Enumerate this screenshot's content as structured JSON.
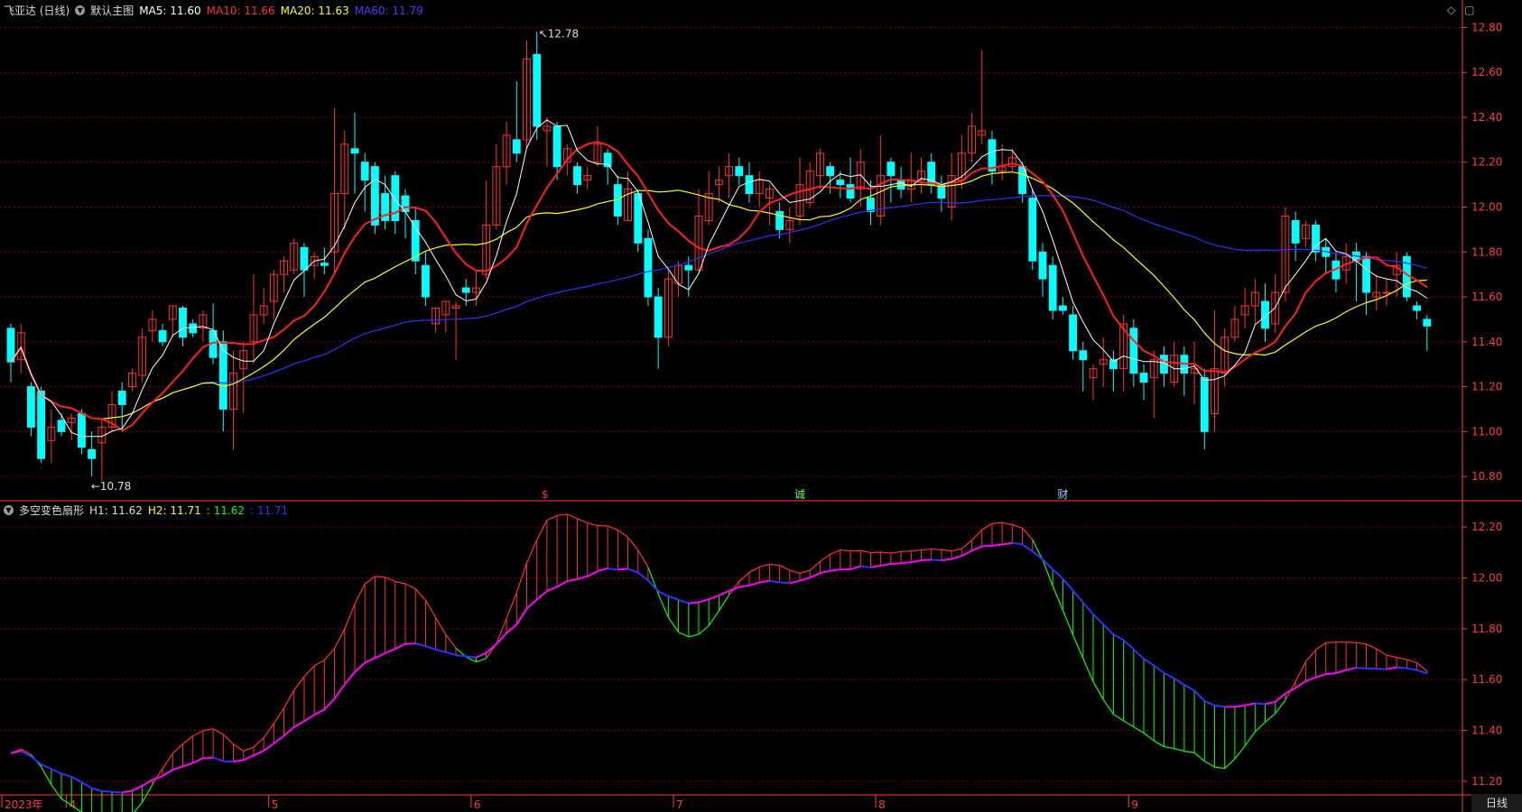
{
  "header": {
    "stock_name": "飞亚达 (日线)",
    "template": "默认主图",
    "ma5": "MA5: 11.60",
    "ma10": "MA10: 11.66",
    "ma20": "MA20: 11.63",
    "ma60": "MA60: 11.79"
  },
  "sub_header": {
    "indicator": "多空变色扇形",
    "h1": "H1: 11.62",
    "h2": "H2: 11.71",
    "v3": ": 11.62",
    "v4": ": 11.71"
  },
  "window_icons": {
    "diamond": "diamond-icon",
    "window": "window-icon"
  },
  "period_label": "日线",
  "colors": {
    "up": "#ff3232",
    "down": "#00ffff",
    "ma5": "#ffffff",
    "ma10": "#ff2020",
    "ma20": "#ffff00",
    "ma60": "#3030ff",
    "h1_up": "#ff3030",
    "h1_down": "#00ff00",
    "h2_rise": "#ff00ff",
    "h2_fall": "#3030ff",
    "grid": "#7a0000",
    "axis": "#ff3c3c"
  },
  "chart_data": [
    {
      "type": "candlestick",
      "title": "飞亚达 (日线)",
      "ylim": [
        10.7,
        12.85
      ],
      "y_ticks": [
        "12.80",
        "12.60",
        "12.40",
        "12.20",
        "12.00",
        "11.80",
        "11.60",
        "11.40",
        "11.20",
        "11.00",
        "10.80"
      ],
      "annotations": {
        "high": "12.78",
        "low": "10.78"
      },
      "event_marks": [
        "$",
        "诚",
        "财"
      ],
      "candles": [
        [
          11.46,
          11.31,
          11.48,
          11.22
        ],
        [
          11.32,
          11.44,
          11.48,
          11.26
        ],
        [
          11.2,
          11.02,
          11.22,
          10.98
        ],
        [
          11.18,
          10.88,
          11.2,
          10.86
        ],
        [
          10.96,
          11.02,
          11.1,
          10.86
        ],
        [
          11.05,
          11.0,
          11.08,
          10.98
        ],
        [
          11.04,
          11.06,
          11.08,
          10.96
        ],
        [
          11.08,
          10.93,
          11.1,
          10.9
        ],
        [
          10.92,
          10.88,
          11.0,
          10.8
        ],
        [
          10.95,
          11.02,
          11.06,
          10.78
        ],
        [
          11.02,
          11.12,
          11.18,
          11.0
        ],
        [
          11.18,
          11.12,
          11.22,
          11.0
        ],
        [
          11.2,
          11.26,
          11.28,
          11.18
        ],
        [
          11.25,
          11.42,
          11.46,
          11.22
        ],
        [
          11.45,
          11.5,
          11.54,
          11.4
        ],
        [
          11.45,
          11.4,
          11.48,
          11.38
        ],
        [
          11.5,
          11.56,
          11.56,
          11.42
        ],
        [
          11.55,
          11.42,
          11.56,
          11.38
        ],
        [
          11.48,
          11.44,
          11.5,
          11.42
        ],
        [
          11.46,
          11.52,
          11.54,
          11.4
        ],
        [
          11.45,
          11.33,
          11.57,
          11.3
        ],
        [
          11.4,
          11.1,
          11.45,
          11.0
        ],
        [
          11.1,
          11.26,
          11.36,
          10.92
        ],
        [
          11.28,
          11.36,
          11.4,
          11.08
        ],
        [
          11.4,
          11.52,
          11.7,
          11.3
        ],
        [
          11.52,
          11.56,
          11.64,
          11.48
        ],
        [
          11.58,
          11.7,
          11.72,
          11.5
        ],
        [
          11.7,
          11.76,
          11.78,
          11.62
        ],
        [
          11.72,
          11.84,
          11.86,
          11.7
        ],
        [
          11.82,
          11.72,
          11.84,
          11.6
        ],
        [
          11.74,
          11.78,
          11.8,
          11.68
        ],
        [
          11.75,
          11.74,
          11.82,
          11.7
        ],
        [
          11.8,
          12.06,
          12.44,
          11.7
        ],
        [
          12.06,
          12.28,
          12.34,
          11.9
        ],
        [
          12.26,
          12.24,
          12.42,
          12.06
        ],
        [
          12.2,
          12.12,
          12.24,
          11.98
        ],
        [
          12.18,
          11.92,
          12.2,
          11.88
        ],
        [
          12.06,
          11.94,
          12.14,
          11.9
        ],
        [
          12.14,
          11.94,
          12.16,
          11.88
        ],
        [
          12.05,
          11.98,
          12.08,
          11.86
        ],
        [
          11.94,
          11.76,
          12.0,
          11.7
        ],
        [
          11.74,
          11.6,
          11.8,
          11.56
        ],
        [
          11.48,
          11.55,
          11.55,
          11.44
        ],
        [
          11.52,
          11.58,
          11.58,
          11.44
        ],
        [
          11.55,
          11.56,
          11.58,
          11.32
        ],
        [
          11.64,
          11.62,
          11.68,
          11.56
        ],
        [
          11.62,
          11.64,
          11.72,
          11.56
        ],
        [
          11.7,
          11.92,
          12.12,
          11.68
        ],
        [
          11.92,
          12.18,
          12.28,
          11.9
        ],
        [
          12.18,
          12.32,
          12.38,
          12.1
        ],
        [
          12.3,
          12.24,
          12.56,
          12.2
        ],
        [
          12.3,
          12.66,
          12.74,
          12.26
        ],
        [
          12.68,
          12.36,
          12.78,
          12.3
        ],
        [
          12.34,
          12.36,
          12.4,
          12.18
        ],
        [
          12.36,
          12.18,
          12.38,
          12.12
        ],
        [
          12.2,
          12.26,
          12.28,
          12.14
        ],
        [
          12.18,
          12.1,
          12.2,
          12.06
        ],
        [
          12.12,
          12.14,
          12.18,
          12.08
        ],
        [
          12.2,
          12.28,
          12.36,
          12.18
        ],
        [
          12.24,
          12.18,
          12.26,
          12.1
        ],
        [
          12.1,
          11.96,
          12.14,
          11.92
        ],
        [
          11.94,
          12.08,
          12.16,
          11.94
        ],
        [
          12.06,
          11.84,
          12.08,
          11.8
        ],
        [
          11.86,
          11.6,
          11.9,
          11.56
        ],
        [
          11.6,
          11.42,
          11.64,
          11.28
        ],
        [
          11.42,
          11.68,
          11.72,
          11.38
        ],
        [
          11.66,
          11.74,
          11.76,
          11.6
        ],
        [
          11.74,
          11.72,
          11.78,
          11.6
        ],
        [
          11.72,
          11.96,
          12.08,
          11.7
        ],
        [
          11.94,
          12.06,
          12.16,
          11.92
        ],
        [
          12.1,
          12.12,
          12.18,
          12.02
        ],
        [
          12.14,
          12.18,
          12.24,
          12.04
        ],
        [
          12.18,
          12.14,
          12.22,
          12.1
        ],
        [
          12.14,
          12.06,
          12.2,
          12.02
        ],
        [
          12.06,
          12.12,
          12.16,
          12.0
        ],
        [
          12.04,
          12.08,
          12.1,
          11.92
        ],
        [
          11.98,
          11.9,
          12.02,
          11.86
        ],
        [
          11.9,
          11.94,
          12.0,
          11.84
        ],
        [
          11.96,
          12.1,
          12.22,
          11.92
        ],
        [
          12.02,
          12.16,
          12.2,
          12.0
        ],
        [
          12.14,
          12.24,
          12.26,
          12.08
        ],
        [
          12.18,
          12.14,
          12.2,
          12.06
        ],
        [
          12.12,
          12.1,
          12.16,
          12.04
        ],
        [
          12.1,
          12.04,
          12.22,
          12.02
        ],
        [
          12.08,
          12.2,
          12.26,
          12.0
        ],
        [
          12.04,
          11.98,
          12.12,
          11.92
        ],
        [
          11.96,
          12.14,
          12.32,
          11.92
        ],
        [
          12.2,
          12.14,
          12.22,
          12.02
        ],
        [
          12.12,
          12.08,
          12.18,
          12.04
        ],
        [
          12.08,
          12.12,
          12.24,
          12.02
        ],
        [
          12.12,
          12.16,
          12.22,
          12.06
        ],
        [
          12.2,
          12.1,
          12.24,
          12.06
        ],
        [
          12.1,
          12.04,
          12.14,
          11.98
        ],
        [
          12.0,
          12.14,
          12.24,
          11.94
        ],
        [
          12.12,
          12.24,
          12.32,
          12.08
        ],
        [
          12.24,
          12.36,
          12.42,
          12.2
        ],
        [
          12.32,
          12.34,
          12.7,
          12.28
        ],
        [
          12.3,
          12.16,
          12.34,
          12.1
        ],
        [
          12.16,
          12.18,
          12.28,
          12.12
        ],
        [
          12.18,
          12.22,
          12.26,
          12.16
        ],
        [
          12.18,
          12.06,
          12.2,
          12.02
        ],
        [
          12.04,
          11.76,
          12.08,
          11.72
        ],
        [
          11.8,
          11.68,
          11.84,
          11.6
        ],
        [
          11.74,
          11.54,
          11.78,
          11.5
        ],
        [
          11.56,
          11.54,
          11.6,
          11.52
        ],
        [
          11.52,
          11.36,
          11.56,
          11.32
        ],
        [
          11.36,
          11.32,
          11.4,
          11.18
        ],
        [
          11.24,
          11.28,
          11.3,
          11.14
        ],
        [
          11.3,
          11.32,
          11.42,
          11.2
        ],
        [
          11.32,
          11.28,
          11.36,
          11.18
        ],
        [
          11.28,
          11.48,
          11.52,
          11.18
        ],
        [
          11.46,
          11.26,
          11.5,
          11.2
        ],
        [
          11.26,
          11.22,
          11.3,
          11.14
        ],
        [
          11.24,
          11.32,
          11.36,
          11.06
        ],
        [
          11.34,
          11.26,
          11.38,
          11.2
        ],
        [
          11.22,
          11.34,
          11.4,
          11.2
        ],
        [
          11.34,
          11.26,
          11.38,
          11.16
        ],
        [
          11.26,
          11.28,
          11.4,
          11.12
        ],
        [
          11.24,
          11.0,
          11.28,
          10.92
        ],
        [
          11.08,
          11.28,
          11.54,
          11.0
        ],
        [
          11.26,
          11.42,
          11.46,
          11.2
        ],
        [
          11.42,
          11.5,
          11.56,
          11.4
        ],
        [
          11.52,
          11.56,
          11.64,
          11.46
        ],
        [
          11.56,
          11.62,
          11.68,
          11.48
        ],
        [
          11.58,
          11.46,
          11.66,
          11.4
        ],
        [
          11.48,
          11.62,
          11.7,
          11.44
        ],
        [
          11.62,
          11.96,
          12.0,
          11.58
        ],
        [
          11.94,
          11.84,
          11.98,
          11.76
        ],
        [
          11.86,
          11.92,
          11.94,
          11.82
        ],
        [
          11.92,
          11.8,
          11.94,
          11.76
        ],
        [
          11.82,
          11.78,
          11.86,
          11.7
        ],
        [
          11.76,
          11.68,
          11.8,
          11.62
        ],
        [
          11.72,
          11.78,
          11.84,
          11.66
        ],
        [
          11.8,
          11.76,
          11.84,
          11.58
        ],
        [
          11.78,
          11.62,
          11.8,
          11.52
        ],
        [
          11.6,
          11.62,
          11.7,
          11.54
        ],
        [
          11.62,
          11.62,
          11.68,
          11.56
        ],
        [
          11.7,
          11.74,
          11.8,
          11.6
        ],
        [
          11.78,
          11.6,
          11.8,
          11.58
        ],
        [
          11.56,
          11.54,
          11.58,
          11.5
        ],
        [
          11.5,
          11.47,
          11.52,
          11.36
        ]
      ],
      "ma_latest": {
        "ma5": 11.6,
        "ma10": 11.66,
        "ma20": 11.63,
        "ma60": 11.79
      },
      "x_ticks": [
        {
          "label": "2023年",
          "index": 0
        },
        {
          "label": "4",
          "index": 6
        },
        {
          "label": "5",
          "index": 26
        },
        {
          "label": "6",
          "index": 46
        },
        {
          "label": "7",
          "index": 66
        },
        {
          "label": "8",
          "index": 86
        },
        {
          "label": "9",
          "index": 111
        }
      ]
    },
    {
      "type": "line",
      "title": "多空变色扇形",
      "ylim": [
        11.15,
        12.25
      ],
      "y_ticks": [
        "12.20",
        "12.00",
        "11.80",
        "11.60",
        "11.40",
        "11.20"
      ],
      "series": [
        {
          "name": "H1",
          "latest": 11.62
        },
        {
          "name": "H2",
          "latest": 11.71
        }
      ]
    }
  ]
}
